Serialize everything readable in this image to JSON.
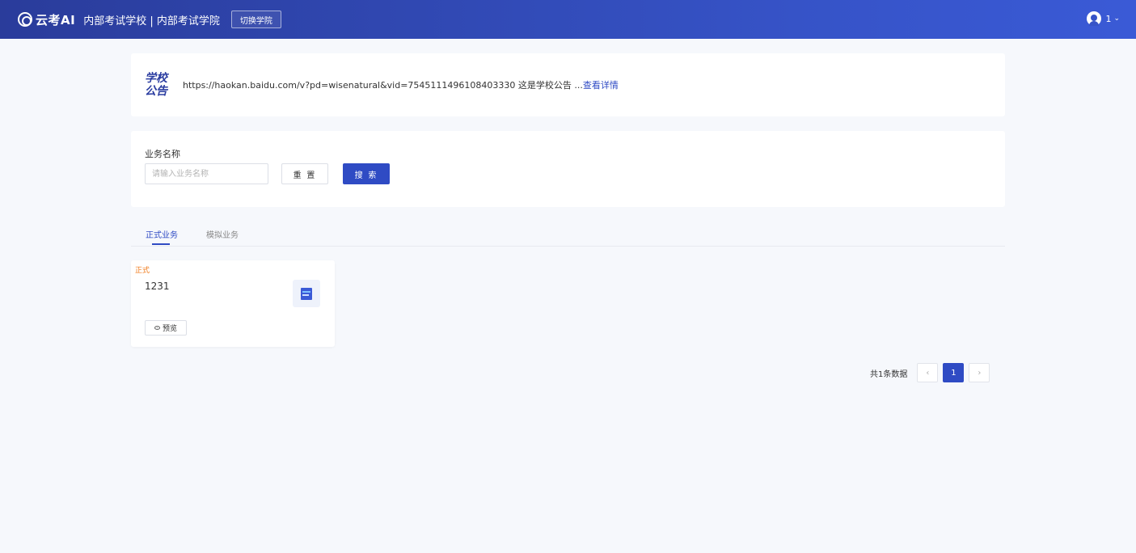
{
  "header": {
    "brand": "云考AI",
    "school_title": "内部考试学校 | 内部考试学院",
    "switch_label": "切换学院",
    "user_name": "1",
    "chevron": "⌄"
  },
  "announcement": {
    "label": "学校公告",
    "text": "https://haokan.baidu.com/v?pd=wisenatural&vid=7545111496108403330 这是学校公告 ...",
    "detail_link": "查看详情"
  },
  "search": {
    "label": "业务名称",
    "placeholder": "请输入业务名称",
    "reset_label": "重 置",
    "search_label": "搜 索"
  },
  "tabs": [
    {
      "label": "正式业务",
      "active": true
    },
    {
      "label": "模拟业务",
      "active": false
    }
  ],
  "cards": [
    {
      "tag": "正式",
      "name": "1231",
      "preview_label": "预览",
      "icon": "document-icon"
    }
  ],
  "pagination": {
    "total_text": "共1条数据",
    "prev": "‹",
    "current": "1",
    "next": "›"
  },
  "colors": {
    "primary": "#2f4bc4",
    "tag_orange": "#f07a1a",
    "background": "#f6f8fc"
  }
}
